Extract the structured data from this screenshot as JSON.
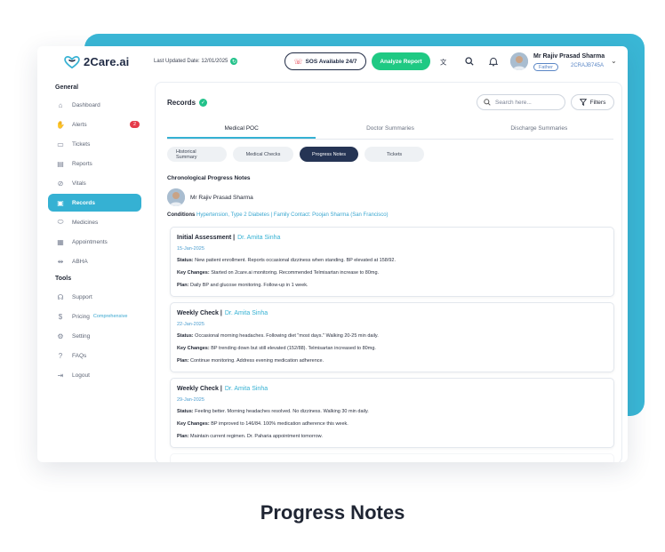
{
  "brand": {
    "name": "2Care.ai"
  },
  "header": {
    "last_updated": "Last Updated Date: 12/01/2025",
    "sos_label": "SOS Available 24/7",
    "analyze_label": "Analyze Report",
    "user_name": "Mr Rajiv Prasad Sharma",
    "relation": "Father",
    "user_id": "2CRAJB745A"
  },
  "sidebar": {
    "general_label": "General",
    "tools_label": "Tools",
    "general_items": [
      {
        "label": "Dashboard",
        "icon": "home-icon"
      },
      {
        "label": "Alerts",
        "icon": "hand-icon",
        "badge": "2"
      },
      {
        "label": "Tickets",
        "icon": "ticket-icon"
      },
      {
        "label": "Reports",
        "icon": "document-icon"
      },
      {
        "label": "Vitals",
        "icon": "vitals-icon"
      },
      {
        "label": "Records",
        "icon": "records-icon",
        "active": true
      },
      {
        "label": "Medicines",
        "icon": "pill-icon"
      },
      {
        "label": "Appointments",
        "icon": "calendar-icon"
      },
      {
        "label": "ABHA",
        "icon": "abha-icon"
      }
    ],
    "tool_items": [
      {
        "label": "Support",
        "icon": "headset-icon"
      },
      {
        "label": "Pricing",
        "icon": "dollar-icon",
        "extra": "Comprehensive"
      },
      {
        "label": "Setting",
        "icon": "gear-icon"
      },
      {
        "label": "FAQs",
        "icon": "question-icon"
      },
      {
        "label": "Logout",
        "icon": "logout-icon"
      }
    ]
  },
  "main": {
    "title": "Records",
    "search_placeholder": "Search here...",
    "filters_label": "Filters",
    "tabs": [
      "Medical POC",
      "Doctor Summaries",
      "Discharge Summaries"
    ],
    "subtabs": [
      "Historical Summary",
      "Medical Checks",
      "Progress Notes",
      "Tickets"
    ],
    "section_title": "Chronological Progress Notes",
    "patient_name": "Mr Rajiv Prasad Sharma",
    "conditions_label": "Conditions",
    "conditions_text": "Hypertension, Type 2 Diabetes | Family Contact: Poojan Sharma (San Francisco)",
    "status_label": "Status:",
    "key_changes_label": "Key Changes:",
    "plan_label": "Plan:",
    "notes": [
      {
        "title": "Initial Assessment |",
        "doctor": "Dr. Amita Sinha",
        "date": "15-Jan-2025",
        "status": "New patient enrollment. Reports occasional dizziness when standing. BP elevated at 158/92.",
        "key_changes": "Started on 2care.ai monitoring. Recommended Telmisartan increase to 80mg.",
        "plan": "Daily BP and glucose monitoring. Follow-up in 1 week."
      },
      {
        "title": "Weekly Check |",
        "doctor": "Dr. Amita Sinha",
        "date": "22-Jan-2025",
        "status": "Occasional morning headaches. Following diet \"most days.\" Walking 20-25 min daily.",
        "key_changes": "BP trending down but still elevated (152/88). Telmisartan increased to 80mg.",
        "plan": "Continue monitoring. Address evening medication adherence."
      },
      {
        "title": "Weekly Check |",
        "doctor": "Dr. Amita Sinha",
        "date": "29-Jan-2025",
        "status": "Feeling better. Morning headaches resolved. No dizziness. Walking 30 min daily.",
        "key_changes": "BP improved to 146/84. 100% medication adherence this week.",
        "plan": "Maintain current regimen. Dr. Paharia appointment tomorrow."
      }
    ]
  },
  "caption": "Progress Notes",
  "colors": {
    "accent": "#35b1d3",
    "green": "#1fc983",
    "navy": "#253454",
    "alert": "#e53b4a"
  }
}
